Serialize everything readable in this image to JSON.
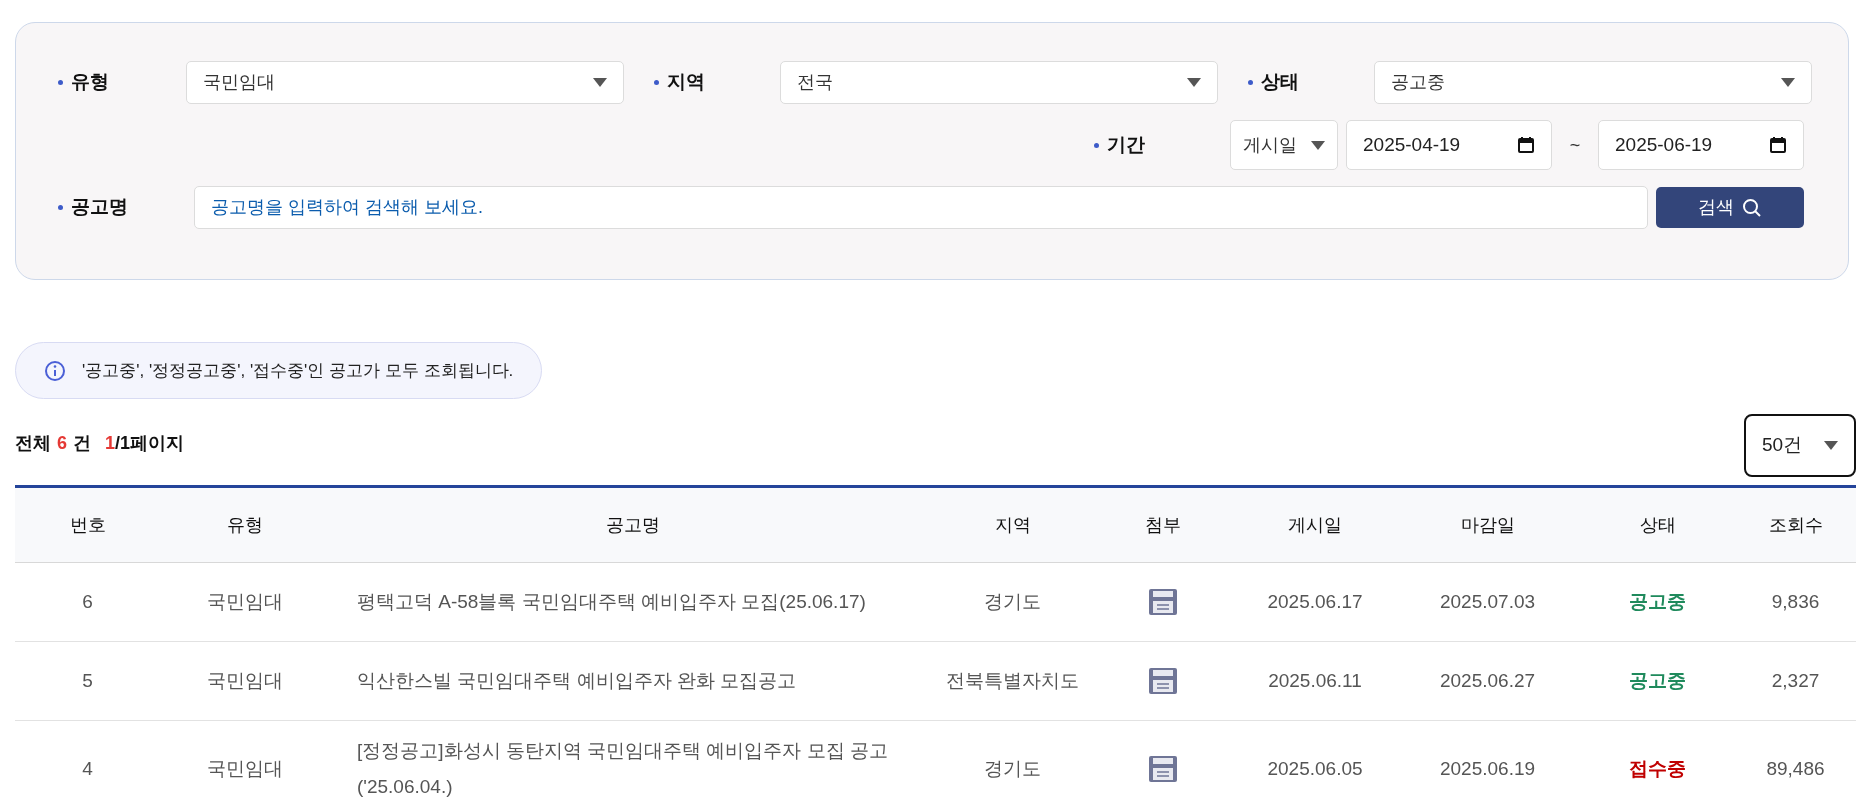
{
  "filters": {
    "type": {
      "label": "유형",
      "value": "국민임대"
    },
    "region": {
      "label": "지역",
      "value": "전국"
    },
    "status": {
      "label": "상태",
      "value": "공고중"
    },
    "period": {
      "label": "기간",
      "basis": "게시일",
      "from": "2025-04-19",
      "separator": "~",
      "to": "2025-06-19"
    },
    "title": {
      "label": "공고명",
      "placeholder": "공고명을 입력하여 검색해 보세요."
    },
    "search_button": "검색"
  },
  "notice": "'공고중', '정정공고중', '접수중'인 공고가 모두 조회됩니다.",
  "summary": {
    "total_label": "전체",
    "total": "6",
    "unit": "건",
    "page": "1",
    "page_rest": "/1페이지"
  },
  "page_size": "50건",
  "table": {
    "columns": [
      "번호",
      "유형",
      "공고명",
      "지역",
      "첨부",
      "게시일",
      "마감일",
      "상태",
      "조회수"
    ],
    "rows": [
      {
        "no": "6",
        "type": "국민임대",
        "title": "평택고덕 A-58블록 국민임대주택 예비입주자 모집(25.06.17)",
        "region": "경기도",
        "attachment": true,
        "posted": "2025.06.17",
        "deadline": "2025.07.03",
        "status": {
          "text": "공고중",
          "color": "#1f8a5c"
        },
        "views": "9,836"
      },
      {
        "no": "5",
        "type": "국민임대",
        "title": "익산한스빌 국민임대주택 예비입주자 완화 모집공고",
        "region": "전북특별자치도",
        "attachment": true,
        "posted": "2025.06.11",
        "deadline": "2025.06.27",
        "status": {
          "text": "공고중",
          "color": "#1f8a5c"
        },
        "views": "2,327"
      },
      {
        "no": "4",
        "type": "국민임대",
        "title": "[정정공고]화성시 동탄지역 국민임대주택 예비입주자 모집 공고 ('25.06.04.)",
        "region": "경기도",
        "attachment": true,
        "posted": "2025.06.05",
        "deadline": "2025.06.19",
        "status": {
          "text": "접수중",
          "color": "#c00000"
        },
        "views": "89,486"
      }
    ]
  }
}
